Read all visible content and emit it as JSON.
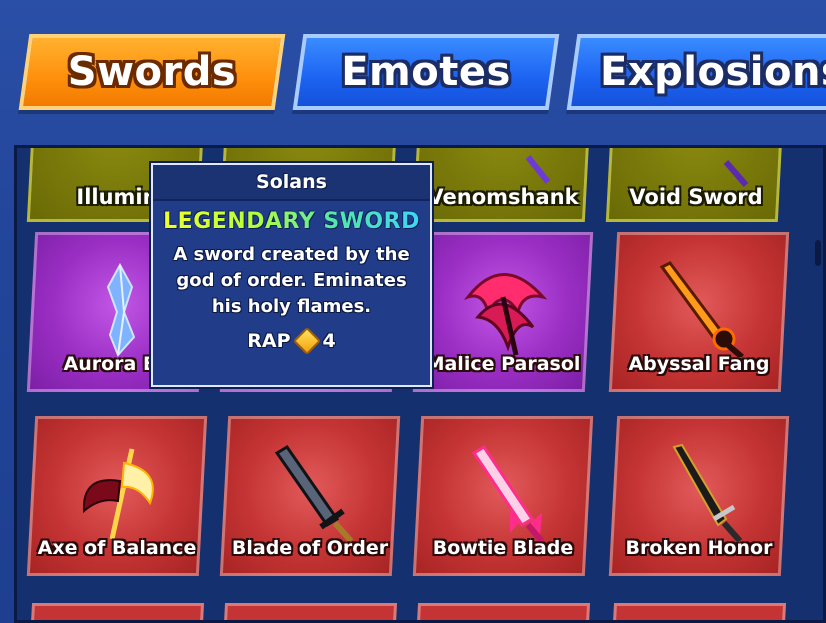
{
  "tabs": [
    {
      "label": "Swords",
      "active": true
    },
    {
      "label": "Emotes",
      "active": false
    },
    {
      "label": "Explosions",
      "active": false
    }
  ],
  "tooltip": {
    "name": "Solans",
    "rarity": "LEGENDARY SWORD",
    "description": "A sword created by the god of order. Eminates his holy flames.",
    "rap_label": "RAP",
    "rap_value": "4",
    "rap_icon": "gem-icon"
  },
  "grid": {
    "row_top": [
      {
        "name": "Illumin",
        "rarity_color": "olive"
      },
      {
        "name": "",
        "rarity_color": "olive"
      },
      {
        "name": "Venomshank",
        "rarity_color": "olive"
      },
      {
        "name": "Void Sword",
        "rarity_color": "olive"
      }
    ],
    "row_middle": [
      {
        "name": "Aurora Bo",
        "rarity_color": "purple"
      },
      {
        "name": "",
        "rarity_color": "purple"
      },
      {
        "name": "Malice Parasol",
        "rarity_color": "purple"
      },
      {
        "name": "Abyssal Fang",
        "rarity_color": "red"
      }
    ],
    "row_bottom": [
      {
        "name": "Axe of Balance",
        "rarity_color": "red"
      },
      {
        "name": "Blade of Order",
        "rarity_color": "red"
      },
      {
        "name": "Bowtie Blade",
        "rarity_color": "red"
      },
      {
        "name": "Broken Honor",
        "rarity_color": "red"
      }
    ]
  },
  "colors": {
    "background": "#22459a",
    "tab_active": "#ff8f0c",
    "tab_inactive": "#1c63f2",
    "card_red": "#c53434",
    "card_purple": "#9a2ec4",
    "card_olive": "#6a6a06"
  }
}
